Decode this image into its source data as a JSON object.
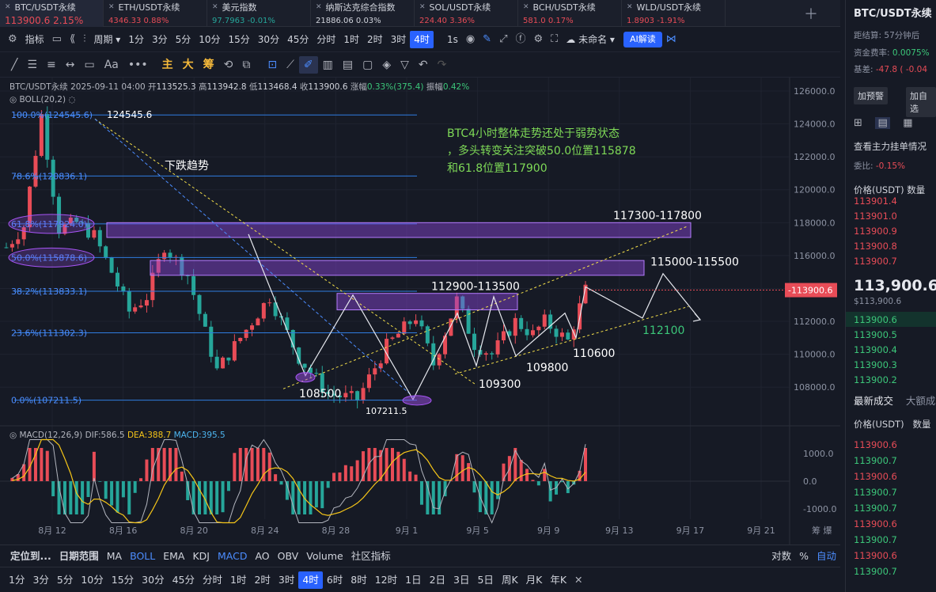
{
  "tabs": [
    {
      "name": "BTC/USDT永续",
      "price": "113900.6",
      "change": "2.15%",
      "dir": "up",
      "active": true
    },
    {
      "name": "ETH/USDT永续",
      "price": "4346.33",
      "change": "0.88%",
      "dir": "up"
    },
    {
      "name": "美元指数",
      "price": "97.7963",
      "change": "-0.01%",
      "dir": "dn"
    },
    {
      "name": "纳斯达克综合指数",
      "price": "21886.06",
      "change": "0.03%",
      "dir": "flat"
    },
    {
      "name": "SOL/USDT永续",
      "price": "224.40",
      "change": "3.36%",
      "dir": "up"
    },
    {
      "name": "BCH/USDT永续",
      "price": "581.0",
      "change": "0.17%",
      "dir": "up"
    },
    {
      "name": "WLD/USDT永续",
      "price": "1.8903",
      "change": "-1.91%",
      "dir": "up"
    }
  ],
  "toolbar": {
    "indicator": "指标",
    "period": "周期",
    "intervals": [
      "1分",
      "3分",
      "5分",
      "10分",
      "15分",
      "30分",
      "45分",
      "分时",
      "1时",
      "2时",
      "3时",
      "4时"
    ],
    "active_interval": "4时",
    "seconds": "1s",
    "layout_name": "未命名",
    "ai": "AI解读"
  },
  "drawbar": {
    "items": [
      "主",
      "大",
      "筹"
    ]
  },
  "legend": {
    "symbol": "BTC/USDT永续",
    "date": "2025-09-11 04:00",
    "open_label": "开",
    "open": "113525.3",
    "high_label": "高",
    "high": "113942.8",
    "low_label": "低",
    "low": "113468.4",
    "close_label": "收",
    "close": "113900.6",
    "chg_label": "涨幅",
    "chg": "0.33%(375.4)",
    "amp_label": "振幅",
    "amp": "0.42%",
    "boll": "BOLL(20,2)"
  },
  "macd_legend": {
    "name": "MACD(12,26,9)",
    "dif": "DIF:586.5",
    "dea": "DEA:388.7",
    "macd": "MACD:395.5"
  },
  "chart_data": {
    "type": "candlestick",
    "y_axis": {
      "min": 107000,
      "max": 126000,
      "ticks": [
        108000,
        110000,
        112000,
        114000,
        116000,
        118000,
        120000,
        122000,
        124000,
        126000
      ]
    },
    "x_ticks": [
      "8月 12",
      "8月 16",
      "8月 20",
      "8月 24",
      "8月 28",
      "9月 1",
      "9月 5",
      "9月 9",
      "9月 13",
      "9月 17",
      "9月 21"
    ],
    "last_price": "113900.6",
    "fib_levels": [
      {
        "label": "100.0%(124545.6)",
        "price": 124545.6
      },
      {
        "label": "78.6%(120836.1)",
        "price": 120836.1
      },
      {
        "label": "61.8%(117924.0)",
        "price": 117924.0
      },
      {
        "label": "50.0%(115878.6)",
        "price": 115878.6
      },
      {
        "label": "38.2%(113833.1)",
        "price": 113833.1
      },
      {
        "label": "23.6%(111302.3)",
        "price": 111302.3
      },
      {
        "label": "0.0%(107211.5)",
        "price": 107211.5
      }
    ],
    "zones": [
      {
        "label": "117300-117800",
        "low": 117300,
        "high": 117800
      },
      {
        "label": "115000-115500",
        "low": 115000,
        "high": 115500
      },
      {
        "label": "112900-113500",
        "low": 112900,
        "high": 113500
      }
    ],
    "price_labels": [
      "124545.6",
      "108500",
      "107211.5",
      "109300",
      "109800",
      "110600",
      "112100"
    ],
    "annotation": "BTC4小时整体走势还处于弱势状态，多头转变关注突破50.0位置115878和61.8位置117900",
    "trend_label": "下跌趋势",
    "macd_ticks": [
      "1000.0",
      "0.0",
      "-1000.0"
    ]
  },
  "bottom1": [
    "定位到...",
    "日期范围",
    "MA",
    "BOLL",
    "EMA",
    "KDJ",
    "MACD",
    "AO",
    "OBV",
    "Volume",
    "社区指标",
    "对数",
    "%",
    "自动"
  ],
  "bottom2": [
    "1分",
    "3分",
    "5分",
    "10分",
    "15分",
    "30分",
    "45分",
    "分时",
    "1时",
    "2时",
    "3时",
    "4时",
    "6时",
    "8时",
    "12时",
    "1日",
    "2日",
    "3日",
    "5日",
    "周K",
    "月K",
    "年K"
  ],
  "right": {
    "title": "BTC/USDT永续",
    "countdown_label": "距结算:",
    "countdown": "57分钟后",
    "funding_label": "资金费率:",
    "funding": "0.0075%",
    "basis_label": "基差:",
    "basis": "-47.8 ( -0.04",
    "alert": "加预警",
    "watch": "加自选",
    "depth_title": "查看主力挂单情况",
    "ratio_label": "委比:",
    "ratio": "-0.15%",
    "col_price": "价格(USDT)",
    "col_qty": "数量",
    "asks": [
      "113901.4",
      "113901.0",
      "113900.9",
      "113900.8",
      "113900.7"
    ],
    "last": "113,900.6",
    "last_usd": "$113,900.6",
    "bids": [
      "113900.6",
      "113900.5",
      "113900.4",
      "113900.3",
      "113900.2"
    ],
    "trades_title": "最新成交",
    "big_trades": "大额成",
    "trades": [
      [
        "113900.6",
        "up"
      ],
      [
        "113900.7",
        "dn"
      ],
      [
        "113900.6",
        "up"
      ],
      [
        "113900.7",
        "dn"
      ],
      [
        "113900.7",
        "dn"
      ],
      [
        "113900.6",
        "up"
      ],
      [
        "113900.7",
        "dn"
      ],
      [
        "113900.6",
        "up"
      ],
      [
        "113900.7",
        "dn"
      ]
    ]
  }
}
